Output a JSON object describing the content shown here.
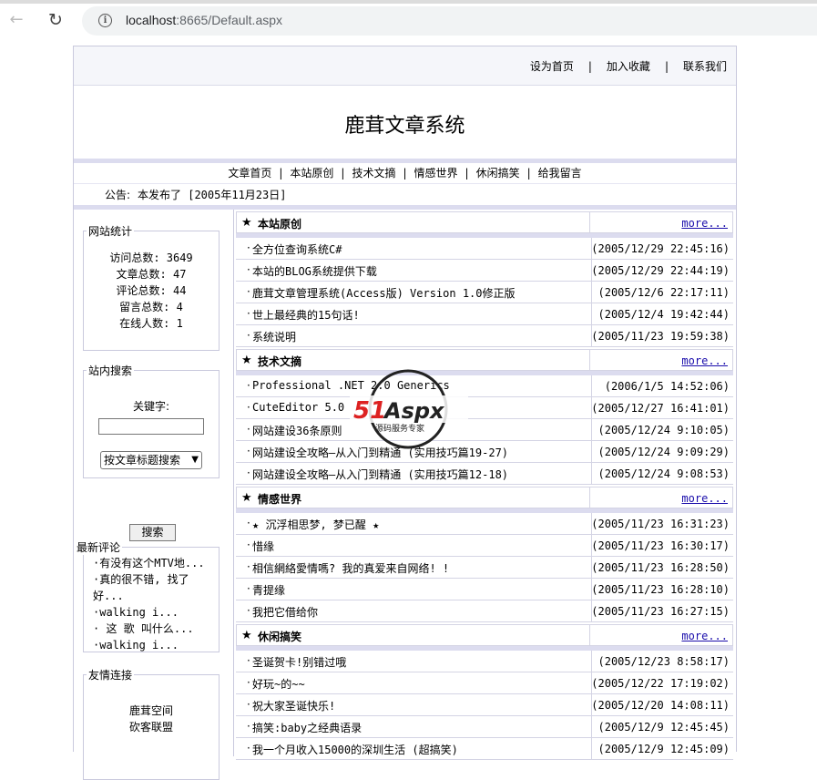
{
  "browser": {
    "url_host": "localhost",
    "url_rest": ":8665/Default.aspx"
  },
  "header": {
    "links": [
      "设为首页",
      "加入收藏",
      "联系我们"
    ],
    "title": "鹿茸文章系统"
  },
  "nav": {
    "items": [
      "文章首页",
      "本站原创",
      "技术文摘",
      "情感世界",
      "休闲搞笑",
      "给我留言"
    ]
  },
  "notice": {
    "label": "公告:",
    "text": "本发布了 [2005年11月23日]"
  },
  "sidebar": {
    "stats_title": "网站统计",
    "stats": [
      "访问总数: 3649",
      "文章总数: 47",
      "评论总数: 44",
      "留言总数: 4",
      "在线人数: 1"
    ],
    "search_title": "站内搜索",
    "keyword_label": "关键字:",
    "keyword_value": "",
    "search_type": "按文章标题搜索",
    "search_button": "搜索",
    "comments_title": "最新评论",
    "comments": [
      "·有没有这个MTV地...",
      "·真的很不错, 找了好...",
      "·walking i...",
      "· 这 歌 叫什么...",
      "·walking i..."
    ],
    "links_title": "友情连接",
    "links": [
      "鹿茸空间",
      "砍客联盟"
    ]
  },
  "sections": [
    {
      "name": "本站原创",
      "more": "more...",
      "items": [
        {
          "title": "全方位查询系统C#",
          "date": "(2005/12/29 22:45:16)"
        },
        {
          "title": "本站的BLOG系统提供下载",
          "date": "(2005/12/29 22:44:19)"
        },
        {
          "title": "鹿茸文章管理系统(Access版) Version 1.0修正版",
          "date": "(2005/12/6 22:17:11)"
        },
        {
          "title": "世上最经典的15句话!",
          "date": "(2005/12/4 19:42:44)"
        },
        {
          "title": "系统说明",
          "date": "(2005/11/23 19:59:38)"
        }
      ]
    },
    {
      "name": "技术文摘",
      "more": "more...",
      "items": [
        {
          "title": "Professional .NET 2.0 Generics",
          "date": "(2006/1/5 14:52:06)"
        },
        {
          "title": "CuteEditor 5.0",
          "date": "(2005/12/27 16:41:01)"
        },
        {
          "title": "网站建设36条原则",
          "date": "(2005/12/24 9:10:05)"
        },
        {
          "title": "网站建设全攻略—从入门到精通 (实用技巧篇19-27)",
          "date": "(2005/12/24 9:09:29)"
        },
        {
          "title": "网站建设全攻略—从入门到精通 (实用技巧篇12-18)",
          "date": "(2005/12/24 9:08:53)"
        }
      ]
    },
    {
      "name": "情感世界",
      "more": "more...",
      "items": [
        {
          "title": "★ 沉浮相思梦, 梦已醒 ★",
          "date": "(2005/11/23 16:31:23)"
        },
        {
          "title": "惜缘",
          "date": "(2005/11/23 16:30:17)"
        },
        {
          "title": "相信網絡愛情嗎? 我的真爱来自网络! !",
          "date": "(2005/11/23 16:28:50)"
        },
        {
          "title": "青提缘",
          "date": "(2005/11/23 16:28:10)"
        },
        {
          "title": "我把它借给你",
          "date": "(2005/11/23 16:27:15)"
        }
      ]
    },
    {
      "name": "休闲搞笑",
      "more": "more...",
      "items": [
        {
          "title": "圣诞贺卡!别错过哦",
          "date": "(2005/12/23 8:58:17)"
        },
        {
          "title": "好玩~的~~",
          "date": "(2005/12/22 17:19:02)"
        },
        {
          "title": "祝大家圣诞快乐!",
          "date": "(2005/12/20 14:08:11)"
        },
        {
          "title": "搞笑:baby之经典语录",
          "date": "(2005/12/9 12:45:45)"
        },
        {
          "title": "我一个月收入15000的深圳生活 (超搞笑)",
          "date": "(2005/12/9 12:45:09)"
        }
      ]
    }
  ],
  "watermark": {
    "brand": "51Aspx",
    "tagline": "源码服务专家"
  }
}
